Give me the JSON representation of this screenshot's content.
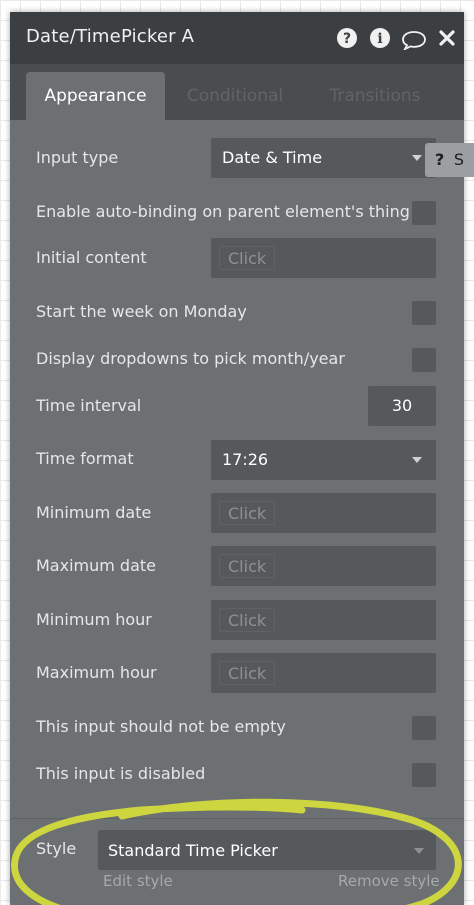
{
  "window": {
    "title": "Date/TimePicker A",
    "icons": [
      "help-icon",
      "info-icon",
      "comment-icon",
      "close-icon"
    ]
  },
  "tabs": [
    {
      "label": "Appearance",
      "active": true
    },
    {
      "label": "Conditional",
      "active": false
    },
    {
      "label": "Transitions",
      "active": false
    }
  ],
  "side_chip": {
    "icon": "?",
    "label": "S"
  },
  "properties": {
    "input_type": {
      "label": "Input type",
      "value": "Date & Time"
    },
    "auto_binding": {
      "label": "Enable auto-binding on parent element's thing",
      "checked": false
    },
    "initial_content": {
      "label": "Initial content",
      "placeholder": "Click"
    },
    "week_monday": {
      "label": "Start the week on Monday",
      "checked": false
    },
    "dropdowns_month_year": {
      "label": "Display dropdowns to pick month/year",
      "checked": false
    },
    "time_interval": {
      "label": "Time interval",
      "value": "30"
    },
    "time_format": {
      "label": "Time format",
      "value": "17:26"
    },
    "min_date": {
      "label": "Minimum date",
      "placeholder": "Click"
    },
    "max_date": {
      "label": "Maximum date",
      "placeholder": "Click"
    },
    "min_hour": {
      "label": "Minimum hour",
      "placeholder": "Click"
    },
    "max_hour": {
      "label": "Maximum hour",
      "placeholder": "Click"
    },
    "not_empty": {
      "label": "This input should not be empty",
      "checked": false
    },
    "disabled": {
      "label": "This input is disabled",
      "checked": false
    }
  },
  "style": {
    "label": "Style",
    "value": "Standard Time Picker",
    "edit_link": "Edit style",
    "remove_link": "Remove style"
  },
  "colors": {
    "panel": "#6c7072",
    "titlebar": "#3c3f41",
    "field": "#56595b",
    "highlight": "#d8e03a"
  }
}
